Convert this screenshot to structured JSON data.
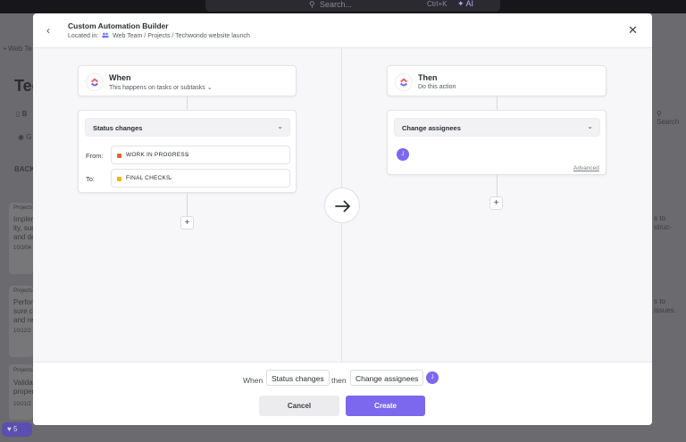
{
  "topbar": {
    "search_placeholder": "Search...",
    "shortcut": "Ctrl+K",
    "ai_label": "AI"
  },
  "background": {
    "breadcrumb": "Web Te",
    "page_title": "Tec",
    "tab": "B",
    "search": "Search",
    "group": "G",
    "column": "BACKL",
    "cards": [
      {
        "tag": "Projects",
        "line1": "Impler",
        "line2": "ity, suc",
        "line3": "and da",
        "date": "10/3/04"
      },
      {
        "tag": "Projects",
        "line1": "Perfor",
        "line2": "sure c",
        "line3": "and re",
        "date": "10/12/2"
      },
      {
        "tag": "Projects",
        "line1": "Valida",
        "line2": "proper",
        "line3": "",
        "date": "10/21/2"
      }
    ],
    "right_snippets": [
      "s to",
      "struc-",
      "s to",
      "issues."
    ],
    "badge": "5"
  },
  "modal": {
    "title": "Custom Automation Builder",
    "location_prefix": "Located in:",
    "location_path": "Web Team / Projects / Techwondo website launch"
  },
  "trigger": {
    "title": "When",
    "subtitle": "This happens on tasks or subtasks",
    "selected": "Status changes",
    "from_label": "From:",
    "from_status": "WORK IN PROGRESS",
    "from_color": "#e8622a",
    "to_label": "To:",
    "to_status": "FINAL CHECKS",
    "to_color": "#f5b400"
  },
  "action": {
    "title": "Then",
    "subtitle": "Do this action",
    "selected": "Change assignees",
    "avatar_initial": "J",
    "advanced_label": "Advanced"
  },
  "summary": {
    "when": "When",
    "trigger": "Status changes",
    "then": "then",
    "action": "Change assignees",
    "avatar_initial": "J"
  },
  "footer": {
    "cancel_label": "Cancel",
    "create_label": "Create"
  },
  "colors": {
    "accent": "#7b68ee"
  }
}
